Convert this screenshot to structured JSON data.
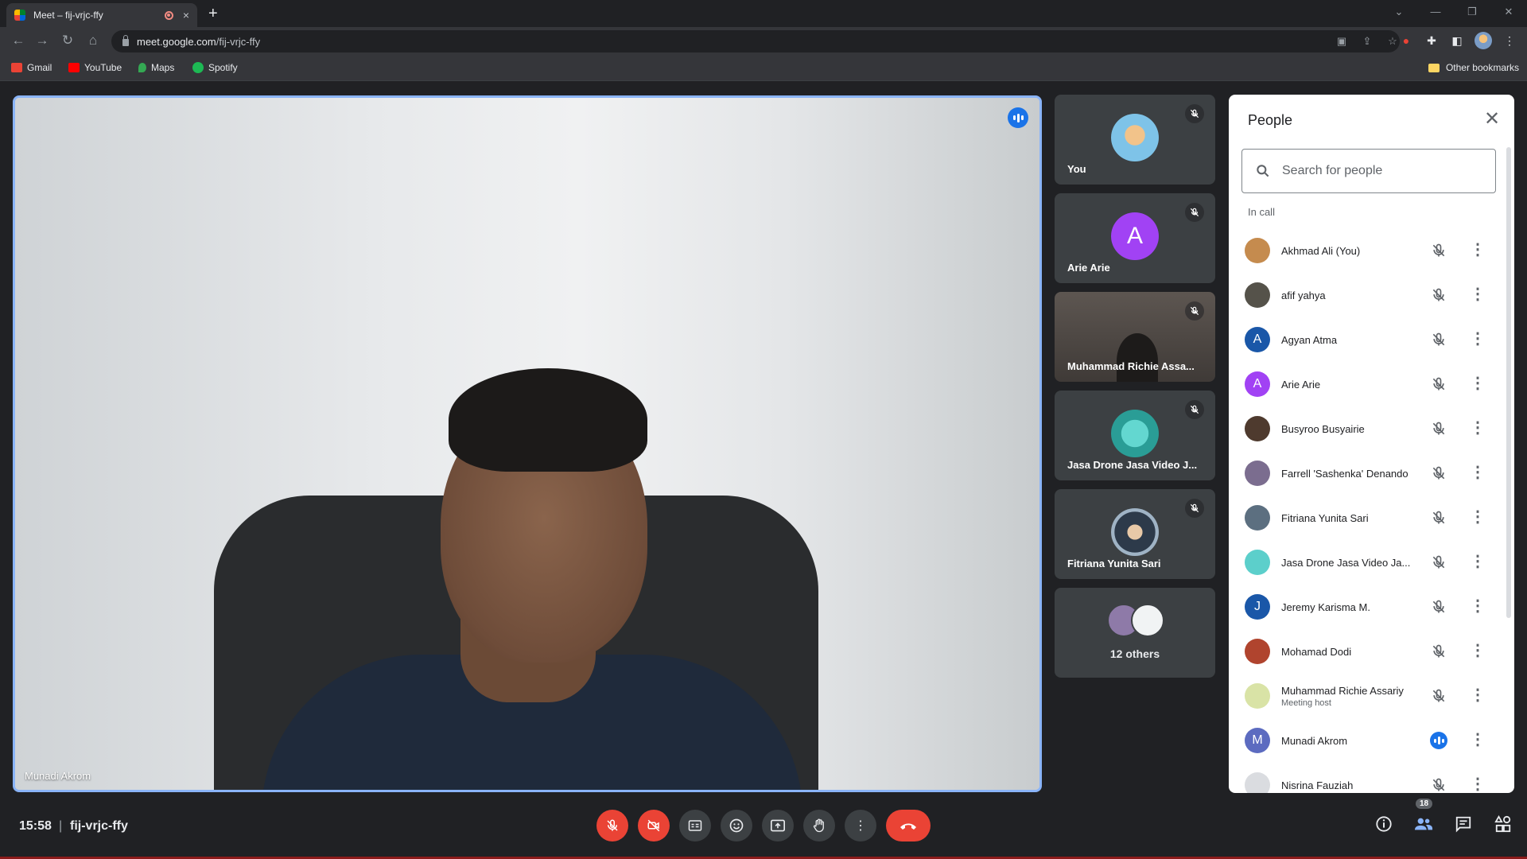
{
  "browser": {
    "tab_title": "Meet – fij-vrjc-ffy",
    "tab_close": "×",
    "new_tab": "+",
    "url_host": "meet.google.com",
    "url_path": "/fij-vrjc-ffy",
    "bookmarks": [
      "Gmail",
      "YouTube",
      "Maps",
      "Spotify"
    ],
    "other_bookmarks": "Other bookmarks"
  },
  "stage": {
    "speaker_name": "Munadi Akrom"
  },
  "tiles": [
    {
      "name": "You",
      "initial": "",
      "color": "#7ec3e8"
    },
    {
      "name": "Arie Arie",
      "initial": "A",
      "color": "#a142f4"
    },
    {
      "name": "Muhammad Richie Assa...",
      "initial": "",
      "color": ""
    },
    {
      "name": "Jasa Drone Jasa Video J...",
      "initial": "",
      "color": "#3fb4ad"
    },
    {
      "name": "Fitriana Yunita Sari",
      "initial": "",
      "color": "#6d7b8a"
    }
  ],
  "others_tile": {
    "label": "12 others"
  },
  "people_panel": {
    "title": "People",
    "search_placeholder": "Search for people",
    "section_label": "In call",
    "participants": [
      {
        "name": "Akhmad Ali (You)",
        "role": "",
        "initial": "",
        "color": "#c58b4e",
        "speaking": false
      },
      {
        "name": "afif yahya",
        "role": "",
        "initial": "",
        "color": "#55524a",
        "speaking": false
      },
      {
        "name": "Agyan Atma",
        "role": "",
        "initial": "A",
        "color": "#1a57a8",
        "speaking": false
      },
      {
        "name": "Arie Arie",
        "role": "",
        "initial": "A",
        "color": "#a142f4",
        "speaking": false
      },
      {
        "name": "Busyroo Busyairie",
        "role": "",
        "initial": "",
        "color": "#4e3a2e",
        "speaking": false
      },
      {
        "name": "Farrell 'Sashenka' Denando",
        "role": "",
        "initial": "",
        "color": "#7b6d8f",
        "speaking": false
      },
      {
        "name": "Fitriana Yunita Sari",
        "role": "",
        "initial": "",
        "color": "#5c6f80",
        "speaking": false
      },
      {
        "name": "Jasa Drone Jasa Video Ja...",
        "role": "",
        "initial": "",
        "color": "#5ccfcb",
        "speaking": false
      },
      {
        "name": "Jeremy Karisma M.",
        "role": "",
        "initial": "J",
        "color": "#1a57a8",
        "speaking": false
      },
      {
        "name": "Mohamad Dodi",
        "role": "",
        "initial": "",
        "color": "#b0442e",
        "speaking": false
      },
      {
        "name": "Muhammad Richie Assariy",
        "role": "Meeting host",
        "initial": "",
        "color": "#d9e3a6",
        "speaking": false
      },
      {
        "name": "Munadi Akrom",
        "role": "",
        "initial": "M",
        "color": "#5c6bc0",
        "speaking": true
      },
      {
        "name": "Nisrina Fauziah",
        "role": "",
        "initial": "",
        "color": "#dadce0",
        "speaking": false
      }
    ]
  },
  "bottom_bar": {
    "time": "15:58",
    "separator": "|",
    "meeting_code": "fij-vrjc-ffy",
    "people_count": "18"
  },
  "colors": {
    "accent": "#8ab4f8",
    "danger": "#ea4335",
    "speaking": "#1a73e8"
  }
}
